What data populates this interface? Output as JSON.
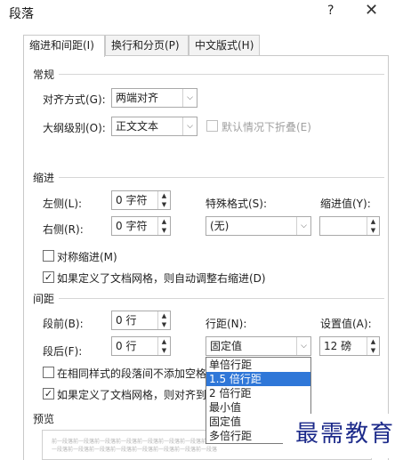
{
  "dialog": {
    "title": "段落",
    "help_label": "?",
    "close_label": "✕"
  },
  "tabs": [
    {
      "label": "缩进和间距(I)"
    },
    {
      "label": "换行和分页(P)"
    },
    {
      "label": "中文版式(H)"
    }
  ],
  "general": {
    "heading": "常规",
    "alignment": {
      "label": "对齐方式(G):",
      "value": "两端对齐"
    },
    "outline": {
      "label": "大纲级别(O):",
      "value": "正文文本"
    },
    "collapse": {
      "label": "默认情况下折叠(E)",
      "checked": false,
      "enabled": false
    }
  },
  "indent": {
    "heading": "缩进",
    "left": {
      "label": "左侧(L):",
      "value": "0 字符"
    },
    "right": {
      "label": "右侧(R):",
      "value": "0 字符"
    },
    "special": {
      "label": "特殊格式(S):",
      "value": "(无)"
    },
    "by": {
      "label": "缩进值(Y):",
      "value": ""
    },
    "mirror": {
      "label": "对称缩进(M)",
      "checked": false
    },
    "auto_adjust": {
      "label": "如果定义了文档网格，则自动调整右缩进(D)",
      "checked": true
    }
  },
  "spacing": {
    "heading": "间距",
    "before": {
      "label": "段前(B):",
      "value": "0 行"
    },
    "after": {
      "label": "段后(F):",
      "value": "0 行"
    },
    "line_spacing": {
      "label": "行距(N):",
      "value": "固定值"
    },
    "at": {
      "label": "设置值(A):",
      "value": "12 磅"
    },
    "no_space_same_style": {
      "label": "在相同样式的段落间不添加空格",
      "checked": false
    },
    "snap_to_grid": {
      "label": "如果定义了文档网格，则对齐到",
      "checked": true
    }
  },
  "line_spacing_options": [
    "单倍行距",
    "1.5 倍行距",
    "2 倍行距",
    "最小值",
    "固定值",
    "多倍行距"
  ],
  "line_spacing_highlighted_index": 1,
  "preview": {
    "heading": "预览",
    "text_line1": "前一段落前一段落前一段落前一段落前一段落前一段落前一段落前一段落前一段落前一段落",
    "text_line2": "一段落前一段落前一段落前一段落前一段落前一段落前一段落前一段落"
  },
  "watermark": "最需教育",
  "icons": {
    "dropdown_arrow": "chevron-down-icon",
    "spin_up": "spin-up-icon",
    "spin_down": "spin-down-icon",
    "check": "checkmark-icon"
  }
}
